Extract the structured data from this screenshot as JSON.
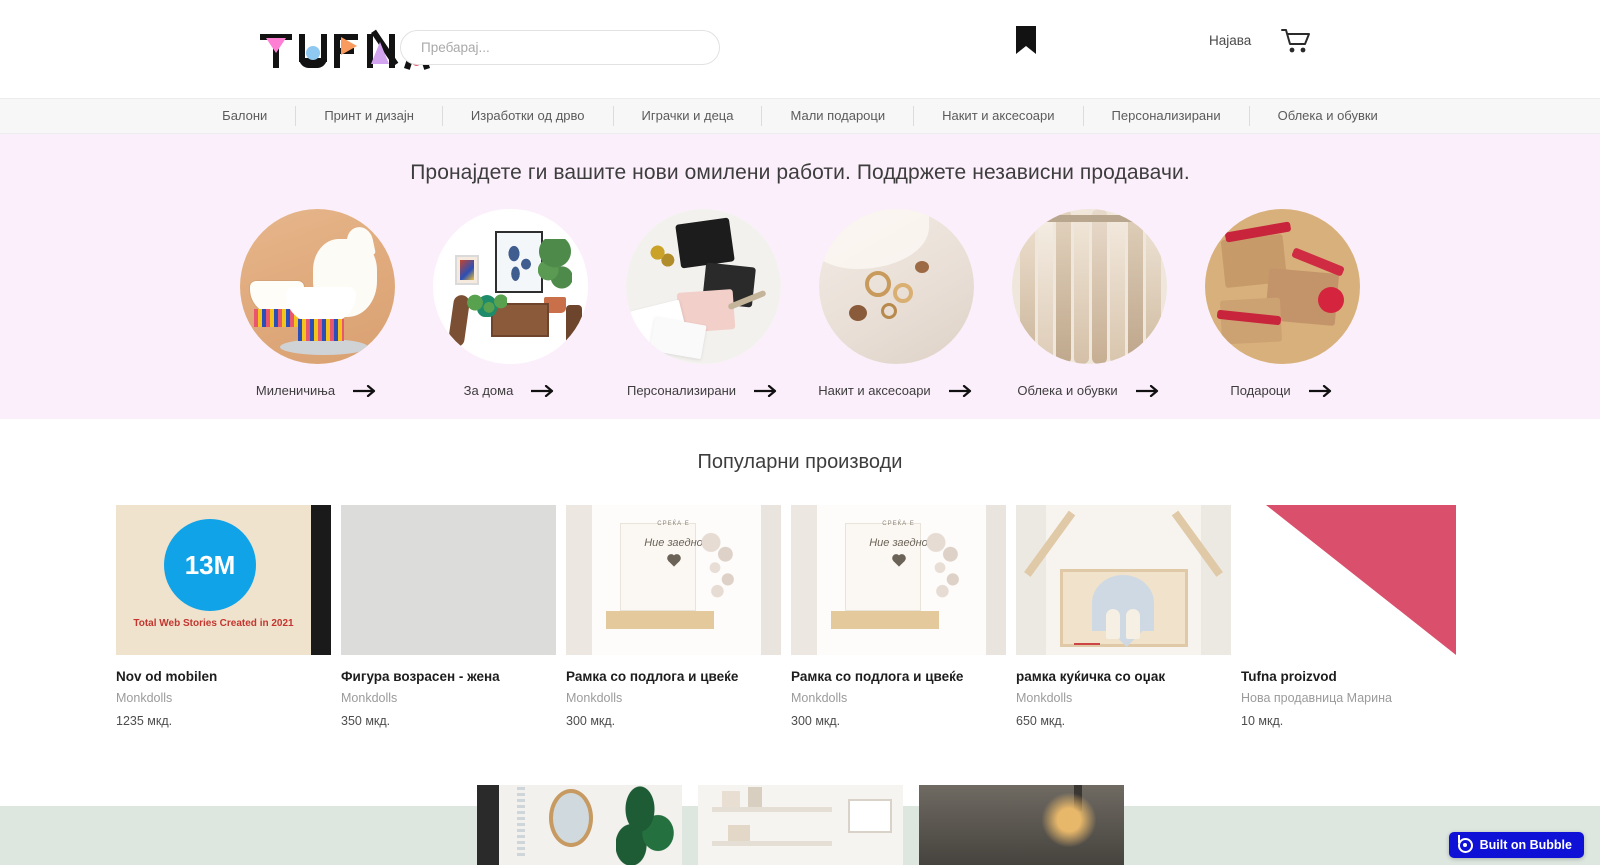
{
  "header": {
    "logo_text": "TUFNA",
    "search": {
      "placeholder": "Пребарај...",
      "value": ""
    },
    "bookmark_icon": "bookmark-icon",
    "login_label": "Најава",
    "cart_icon": "cart-icon"
  },
  "nav": {
    "items": [
      {
        "label": "Балони"
      },
      {
        "label": "Принт и дизајн"
      },
      {
        "label": "Изработки од дрво"
      },
      {
        "label": "Играчки и деца"
      },
      {
        "label": "Мали подароци"
      },
      {
        "label": "Накит и аксесоари"
      },
      {
        "label": "Персонализирани"
      },
      {
        "label": "Облека и обувки"
      }
    ]
  },
  "hero": {
    "headline": "Пронајдете ги вашите нови омилени работи. Поддржете независни продавачи.",
    "background_color": "#fbeffb",
    "categories": [
      {
        "label": "Миленичиња",
        "arrow_icon": "arrow-right-icon"
      },
      {
        "label": "За дома",
        "arrow_icon": "arrow-right-icon"
      },
      {
        "label": "Персонализирани",
        "arrow_icon": "arrow-right-icon"
      },
      {
        "label": "Накит и аксесоари",
        "arrow_icon": "arrow-right-icon"
      },
      {
        "label": "Облека и обувки",
        "arrow_icon": "arrow-right-icon"
      },
      {
        "label": "Подароци",
        "arrow_icon": "arrow-right-icon"
      }
    ]
  },
  "products_section": {
    "title": "Популарни производи",
    "items": [
      {
        "title": "Nov od mobilen",
        "shop": "Monkdolls",
        "price": "1235 мкд.",
        "badge_number": "13M",
        "caption": "Total Web Stories\nCreated in 2021"
      },
      {
        "title": "Фигура возрасен - жена",
        "shop": "Monkdolls",
        "price": "350 мкд."
      },
      {
        "title": "Рамка со подлога и цвеќе",
        "shop": "Monkdolls",
        "price": "300 мкд.",
        "card_top": "СРЕЌА Е",
        "card_script": "Ние заедно"
      },
      {
        "title": "Рамка со подлога и цвеќе",
        "shop": "Monkdolls",
        "price": "300 мкд.",
        "card_top": "СРЕЌА Е",
        "card_script": "Ние заедно"
      },
      {
        "title": "рамка куќичка со оџак",
        "shop": "Monkdolls",
        "price": "650 мкд."
      },
      {
        "title": "Tufna proizvod",
        "shop": "Нова продавница Марина",
        "price": "10 мкд."
      }
    ]
  },
  "footer_strip": {
    "background_color": "#dde7df"
  },
  "bubble_badge": {
    "label": "Built on Bubble",
    "background_color": "#1011d6",
    "icon": "bubble-logo-icon"
  }
}
